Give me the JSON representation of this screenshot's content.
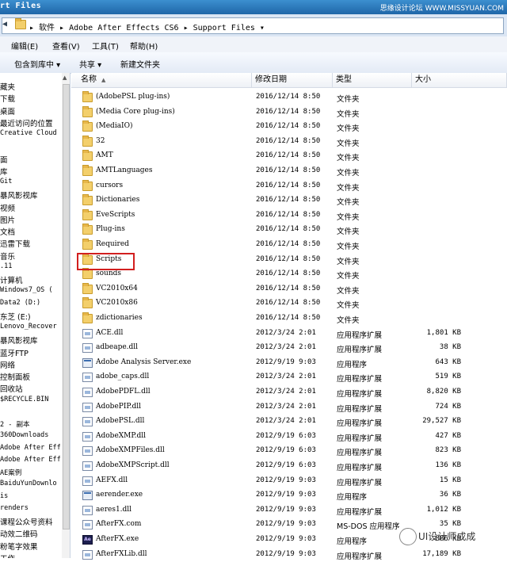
{
  "titlebar": {
    "title": "rt Files",
    "watermark": "思缘设计论坛 WWW.MISSYUAN.COM"
  },
  "address": {
    "nav": "◀",
    "path": "▸ 软件 ▸ Adobe After Effects CS6 ▸ Support Files ▾"
  },
  "menu": [
    "编辑(E)",
    "查看(V)",
    "工具(T)",
    "帮助(H)"
  ],
  "toolbar": [
    "包含到库中 ▾",
    "共享 ▾",
    "新建文件夹"
  ],
  "nav_items": [
    "藏夹",
    "下载",
    "桌面",
    "最近访问的位置",
    "Creative Cloud",
    "",
    "面",
    "库",
    "Git",
    "暴风影视库",
    "视频",
    "图片",
    "文档",
    "迅雷下载",
    "音乐",
    ".11",
    "计算机",
    "Windows7_OS (",
    "Data2 (D:)",
    "东芝 (E:)",
    "Lenovo_Recover",
    "暴风影视库",
    "蓝牙FTP",
    "网络",
    "控制面板",
    "回收站",
    "$RECYCLE.BIN",
    "",
    "2 - 副本",
    "360Downloads",
    "Adobe After Eff",
    "Adobe After Eff",
    "AE案例",
    "BaiduYunDownlo",
    "is",
    "renders",
    "课程公众号资料",
    "动效二维码",
    "粉笔字效果",
    "工作"
  ],
  "columns": {
    "name": "名称",
    "date": "修改日期",
    "type": "类型",
    "size": "大小"
  },
  "rows": [
    {
      "icon": "folder",
      "name": "(AdobePSL plug-ins)",
      "date": "2016/12/14 8:50",
      "type": "文件夹",
      "size": ""
    },
    {
      "icon": "folder",
      "name": "(Media Core plug-ins)",
      "date": "2016/12/14 8:50",
      "type": "文件夹",
      "size": ""
    },
    {
      "icon": "folder",
      "name": "(MediaIO)",
      "date": "2016/12/14 8:50",
      "type": "文件夹",
      "size": ""
    },
    {
      "icon": "folder",
      "name": "32",
      "date": "2016/12/14 8:50",
      "type": "文件夹",
      "size": ""
    },
    {
      "icon": "folder",
      "name": "AMT",
      "date": "2016/12/14 8:50",
      "type": "文件夹",
      "size": ""
    },
    {
      "icon": "folder",
      "name": "AMTLanguages",
      "date": "2016/12/14 8:50",
      "type": "文件夹",
      "size": ""
    },
    {
      "icon": "folder",
      "name": "cursors",
      "date": "2016/12/14 8:50",
      "type": "文件夹",
      "size": ""
    },
    {
      "icon": "folder",
      "name": "Dictionaries",
      "date": "2016/12/14 8:50",
      "type": "文件夹",
      "size": ""
    },
    {
      "icon": "folder",
      "name": "EveScripts",
      "date": "2016/12/14 8:50",
      "type": "文件夹",
      "size": ""
    },
    {
      "icon": "folder",
      "name": "Plug-ins",
      "date": "2016/12/14 8:50",
      "type": "文件夹",
      "size": ""
    },
    {
      "icon": "folder",
      "name": "Required",
      "date": "2016/12/14 8:50",
      "type": "文件夹",
      "size": ""
    },
    {
      "icon": "folder",
      "name": "Scripts",
      "date": "2016/12/14 8:50",
      "type": "文件夹",
      "size": ""
    },
    {
      "icon": "folder",
      "name": "sounds",
      "date": "2016/12/14 8:50",
      "type": "文件夹",
      "size": ""
    },
    {
      "icon": "folder",
      "name": "VC2010x64",
      "date": "2016/12/14 8:50",
      "type": "文件夹",
      "size": ""
    },
    {
      "icon": "folder",
      "name": "VC2010x86",
      "date": "2016/12/14 8:50",
      "type": "文件夹",
      "size": ""
    },
    {
      "icon": "folder",
      "name": "zdictionaries",
      "date": "2016/12/14 8:50",
      "type": "文件夹",
      "size": ""
    },
    {
      "icon": "file",
      "name": "ACE.dll",
      "date": "2012/3/24 2:01",
      "type": "应用程序扩展",
      "size": "1,801 KB"
    },
    {
      "icon": "file",
      "name": "adbeape.dll",
      "date": "2012/3/24 2:01",
      "type": "应用程序扩展",
      "size": "38 KB"
    },
    {
      "icon": "exe",
      "name": "Adobe Analysis Server.exe",
      "date": "2012/9/19 9:03",
      "type": "应用程序",
      "size": "643 KB"
    },
    {
      "icon": "file",
      "name": "adobe_caps.dll",
      "date": "2012/3/24 2:01",
      "type": "应用程序扩展",
      "size": "519 KB"
    },
    {
      "icon": "file",
      "name": "AdobePDFL.dll",
      "date": "2012/3/24 2:01",
      "type": "应用程序扩展",
      "size": "8,820 KB"
    },
    {
      "icon": "file",
      "name": "AdobePIP.dll",
      "date": "2012/3/24 2:01",
      "type": "应用程序扩展",
      "size": "724 KB"
    },
    {
      "icon": "file",
      "name": "AdobePSL.dll",
      "date": "2012/3/24 2:01",
      "type": "应用程序扩展",
      "size": "29,527 KB"
    },
    {
      "icon": "file",
      "name": "AdobeXMP.dll",
      "date": "2012/9/19 6:03",
      "type": "应用程序扩展",
      "size": "427 KB"
    },
    {
      "icon": "file",
      "name": "AdobeXMPFiles.dll",
      "date": "2012/9/19 6:03",
      "type": "应用程序扩展",
      "size": "823 KB"
    },
    {
      "icon": "file",
      "name": "AdobeXMPScript.dll",
      "date": "2012/9/19 6:03",
      "type": "应用程序扩展",
      "size": "136 KB"
    },
    {
      "icon": "file",
      "name": "AEFX.dll",
      "date": "2012/9/19 9:03",
      "type": "应用程序扩展",
      "size": "15 KB"
    },
    {
      "icon": "exe",
      "name": "aerender.exe",
      "date": "2012/9/19 9:03",
      "type": "应用程序",
      "size": "36 KB"
    },
    {
      "icon": "file",
      "name": "aeres1.dll",
      "date": "2012/9/19 9:03",
      "type": "应用程序扩展",
      "size": "1,012 KB"
    },
    {
      "icon": "file",
      "name": "AfterFX.com",
      "date": "2012/9/19 9:03",
      "type": "MS-DOS 应用程序",
      "size": "35 KB"
    },
    {
      "icon": "ae",
      "name": "AfterFX.exe",
      "date": "2012/9/19 9:03",
      "type": "应用程序",
      "size": "886 KB"
    },
    {
      "icon": "file",
      "name": "AfterFXLib.dll",
      "date": "2012/9/19 9:03",
      "type": "应用程序扩展",
      "size": "17,189 KB"
    }
  ],
  "watermark_bottom": "UI设计师成成"
}
